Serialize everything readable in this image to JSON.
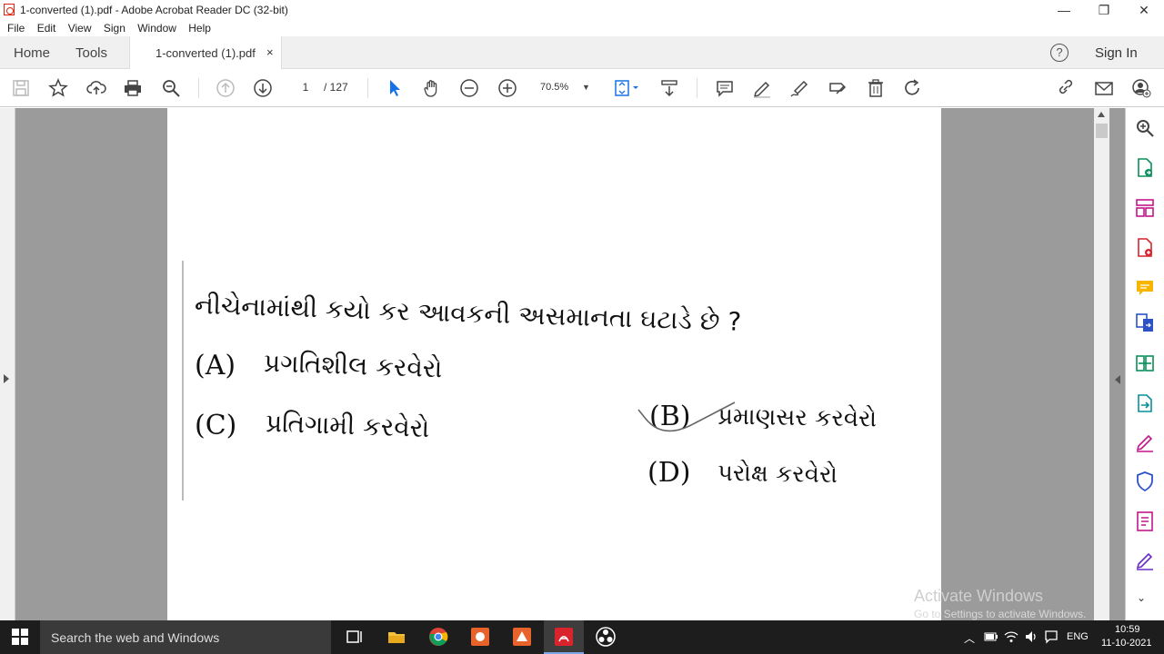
{
  "window": {
    "title": "1-converted (1).pdf - Adobe Acrobat Reader DC (32-bit)",
    "minimize": "—",
    "restore": "❐",
    "close": "✕"
  },
  "menu": [
    "File",
    "Edit",
    "View",
    "Sign",
    "Window",
    "Help"
  ],
  "tabs": {
    "home": "Home",
    "tools": "Tools",
    "document": "1-converted (1).pdf",
    "close": "×"
  },
  "header_right": {
    "help": "?",
    "signin": "Sign In"
  },
  "toolbar": {
    "page_current": "1",
    "page_total": "/ 127",
    "zoom": "70.5%"
  },
  "document": {
    "question": "નીચેનામાંથી કયો કર આવકની અસમાનતા ઘટાડે છે ?",
    "options": [
      {
        "letter": "(A)",
        "text": "પ્રગતિશીલ કરવેરો"
      },
      {
        "letter": "(B)",
        "text": "પ્રમાણસર કરવેરો"
      },
      {
        "letter": "(C)",
        "text": "પ્રતિગામી કરવેરો"
      },
      {
        "letter": "(D)",
        "text": "પરોક્ષ કરવેરો"
      }
    ]
  },
  "watermark": {
    "line1": "Activate Windows",
    "line2": "Go to Settings to activate Windows."
  },
  "taskbar": {
    "search_placeholder": "Search the web and Windows",
    "lang": "ENG",
    "time": "10:59",
    "date": "11-10-2021"
  }
}
